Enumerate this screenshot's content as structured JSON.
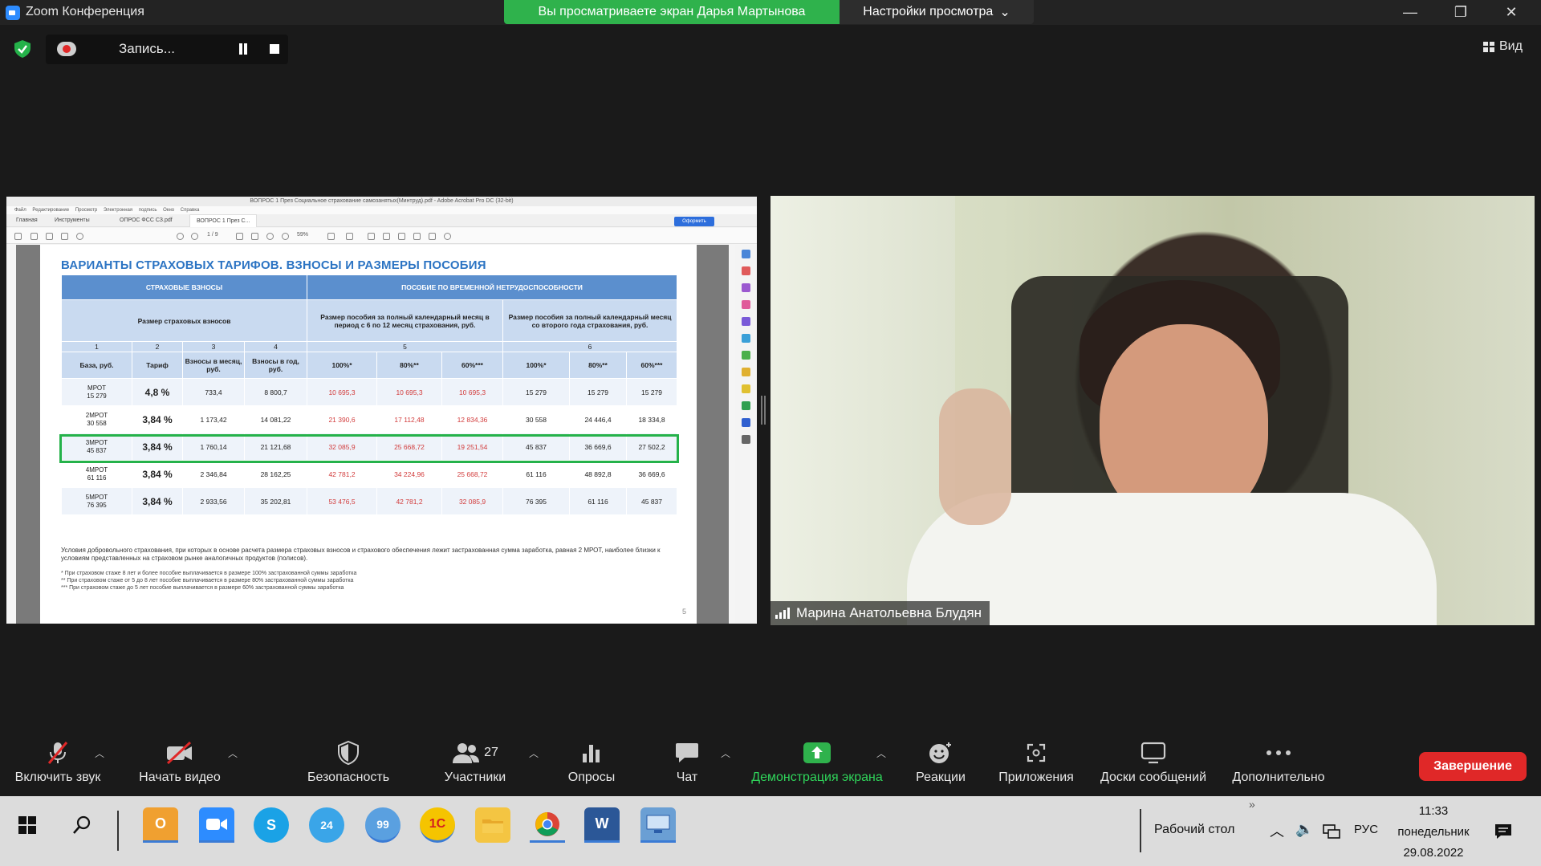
{
  "window": {
    "title": "Zoom Конференция",
    "share_banner": "Вы просматриваете экран Дарья Мартынова",
    "view_settings": "Настройки просмотра",
    "minimize": "—",
    "restore": "❐",
    "close": "✕"
  },
  "recording": {
    "label": "Запись..."
  },
  "view_button": {
    "label": "Вид"
  },
  "acrobat": {
    "title": "ВОПРОС 1 През Социальное страхование самозанятых(Минтруд).pdf - Adobe Acrobat Pro DC (32-bit)",
    "menu": "Файл Редактирование Просмотр Электронная подпись Окно Справка",
    "tabs": [
      "Главная",
      "Инструменты",
      "ОПРОС ФСС СЗ.pdf",
      "ВОПРОС 1 През С..."
    ],
    "share_label": "Оформить",
    "page_indicator": "1 / 9",
    "zoom": "59%"
  },
  "slide": {
    "title": "ВАРИАНТЫ СТРАХОВЫХ ТАРИФОВ. ВЗНОСЫ И РАЗМЕРЫ ПОСОБИЯ",
    "header": {
      "contributions": "СТРАХОВЫЕ ВЗНОСЫ",
      "benefit": "ПОСОБИЕ ПО ВРЕМЕННОЙ НЕТРУДОСПОСОБНОСТИ",
      "contrib_size": "Размер страховых взносов",
      "benefit_6_12": "Размер пособия за полный календарный месяц в период с 6 по 12 месяц страхования, руб.",
      "benefit_year2": "Размер пособия за полный календарный месяц со второго года страхования, руб.",
      "nums": [
        "1",
        "2",
        "3",
        "4",
        "5",
        "6"
      ],
      "cols": [
        "База, руб.",
        "Тариф",
        "Взносы в месяц, руб.",
        "Взносы в год, руб.",
        "100%*",
        "80%**",
        "60%***",
        "100%*",
        "80%**",
        "60%***"
      ]
    },
    "rows": [
      {
        "base1": "МРОТ",
        "base2": "15 279",
        "tarif": "4,8 %",
        "month": "733,4",
        "year": "8 800,7",
        "a100": "10 695,3",
        "a80": "10 695,3",
        "a60": "10 695,3",
        "b100": "15 279",
        "b80": "15 279",
        "b60": "15 279"
      },
      {
        "base1": "2МРОТ",
        "base2": "30 558",
        "tarif": "3,84 %",
        "month": "1 173,42",
        "year": "14 081,22",
        "a100": "21 390,6",
        "a80": "17 112,48",
        "a60": "12 834,36",
        "b100": "30 558",
        "b80": "24 446,4",
        "b60": "18 334,8"
      },
      {
        "base1": "3МРОТ",
        "base2": "45 837",
        "tarif": "3,84 %",
        "month": "1 760,14",
        "year": "21 121,68",
        "a100": "32 085,9",
        "a80": "25 668,72",
        "a60": "19 251,54",
        "b100": "45 837",
        "b80": "36 669,6",
        "b60": "27 502,2"
      },
      {
        "base1": "4МРОТ",
        "base2": "61 116",
        "tarif": "3,84 %",
        "month": "2 346,84",
        "year": "28 162,25",
        "a100": "42 781,2",
        "a80": "34 224,96",
        "a60": "25 668,72",
        "b100": "61 116",
        "b80": "48 892,8",
        "b60": "36 669,6"
      },
      {
        "base1": "5МРОТ",
        "base2": "76 395",
        "tarif": "3,84 %",
        "month": "2 933,56",
        "year": "35 202,81",
        "a100": "53 476,5",
        "a80": "42 781,2",
        "a60": "32 085,9",
        "b100": "76 395",
        "b80": "61 116",
        "b60": "45 837"
      }
    ],
    "note": "Условия добровольного страхования, при которых в основе расчета размера страховых взносов и страхового обеспечения лежит застрахованная сумма заработка, равная 2 МРОТ, наиболее близки к условиям представленных на страховом рынке аналогичных продуктов (полисов).",
    "footnotes": [
      "* При страховом стаже 8 лет и более пособие выплачивается в размере 100% застрахованной суммы заработка",
      "** При страховом стаже от 5 до 8 лет пособие выплачивается в размере 80% застрахованной суммы заработка",
      "*** При страховом стаже до 5 лет пособие выплачивается в размере 60% застрахованной суммы заработка"
    ],
    "page_number": "5"
  },
  "video": {
    "participant_name": "Марина Анатольевна Блудян"
  },
  "toolbar": {
    "mute": "Включить звук",
    "video": "Начать видео",
    "security": "Безопасность",
    "participants": "Участники",
    "participants_count": "27",
    "polls": "Опросы",
    "chat": "Чат",
    "share": "Демонстрация экрана",
    "reactions": "Реакции",
    "apps": "Приложения",
    "whiteboards": "Доски сообщений",
    "more": "Дополнительно",
    "end": "Завершение"
  },
  "taskbar": {
    "desktop": "Рабочий стол",
    "lang": "РУС",
    "time": "11:33",
    "day": "понедельник",
    "date": "29.08.2022",
    "badge_24": "24",
    "badge_99": "99"
  },
  "colors": {
    "share_green": "#2fb24c",
    "end_red": "#e02828",
    "slide_blue": "#2c74c3",
    "highlight_green": "#25b24a"
  }
}
